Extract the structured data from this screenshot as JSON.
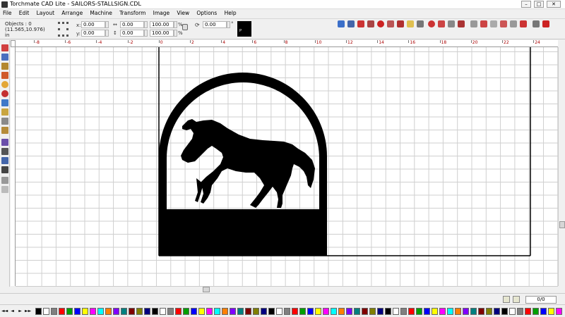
{
  "window": {
    "title": "Torchmate CAD Lite - SAILORS-STALLSIGN.CDL",
    "minimize_glyph": "–",
    "maximize_glyph": "□",
    "close_glyph": "✕"
  },
  "menu": [
    "File",
    "Edit",
    "Layout",
    "Arrange",
    "Machine",
    "Transform",
    "Image",
    "View",
    "Options",
    "Help"
  ],
  "properties": {
    "objects_text": "Objects : 0",
    "coords_text": "(11.565,10.976)",
    "units_text": "in",
    "x_label": "x:",
    "y_label": "y:",
    "x_value": "0.00",
    "y_value": "0.00",
    "width_value": "0.00",
    "height_value": "0.00",
    "scale_x_value": "100.00",
    "scale_y_value": "100.00",
    "percent_x": "%",
    "percent_y": "%",
    "rotation_value": "0.00",
    "rotation_unit": "°",
    "thumb_label": "P"
  },
  "ruler": {
    "labels": [
      "-8",
      "-6",
      "-4",
      "-2",
      "0",
      "2",
      "4",
      "6",
      "8",
      "10",
      "12",
      "14",
      "16",
      "18",
      "20",
      "22",
      "24"
    ]
  },
  "status": {
    "page_value": "0/0"
  },
  "palette": {
    "nav_glyphs": [
      "◄◄",
      "◄",
      "►",
      "►►"
    ],
    "colors": [
      "#000000",
      "#ffffff",
      "#808080",
      "#ff0000",
      "#00a000",
      "#0000ff",
      "#ffff00",
      "#ff00ff",
      "#00ffff",
      "#ff8000",
      "#8000ff",
      "#008080",
      "#800000",
      "#808000",
      "#000080"
    ]
  },
  "icons": {
    "toolbar": [
      "pointer-icon",
      "node-edit-icon",
      "text-icon",
      "shape-icon",
      "zoom-icon",
      "circle-icon",
      "fill-icon",
      "pen-icon",
      "knife-icon",
      "measure-icon",
      "fill-bucket-icon",
      "eye-icon",
      "grid-icon",
      "weld-icon",
      "transform-icon",
      "dimension-icon"
    ],
    "top": [
      "new-icon",
      "open-icon",
      "save-icon",
      "print-icon",
      "cut-icon",
      "copy-icon",
      "paste-icon",
      "folder-icon",
      "undo-icon",
      "redo-icon",
      "group-icon",
      "ungroup-icon",
      "align-icon",
      "order-icon",
      "combine-icon",
      "break-icon",
      "weld-tool-icon",
      "trim-icon",
      "properties-icon",
      "nesting-icon",
      "help-icon"
    ]
  }
}
